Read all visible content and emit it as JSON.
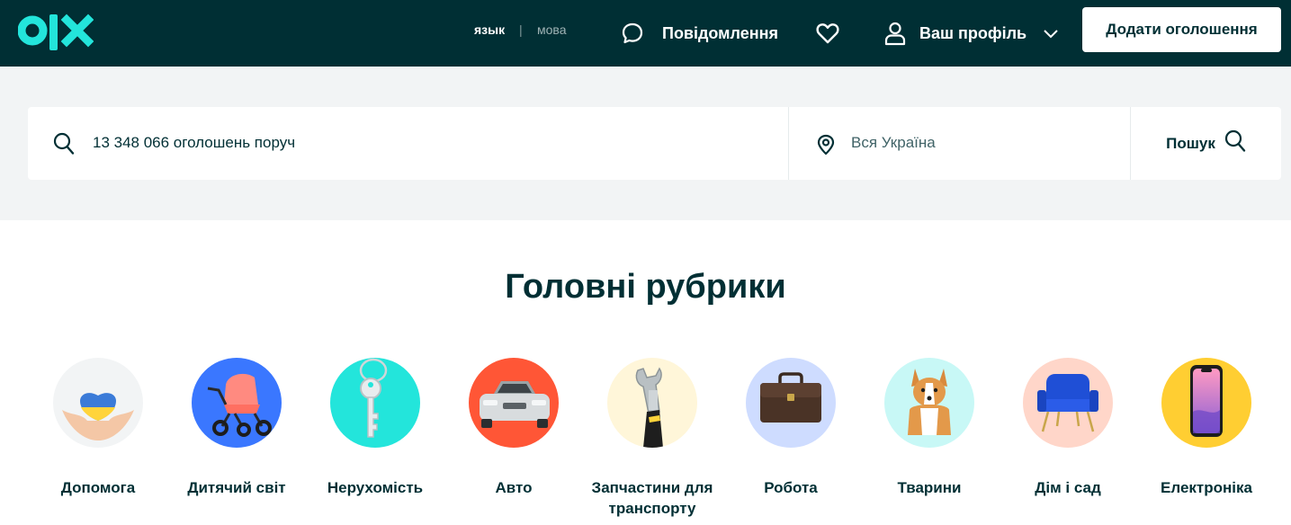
{
  "header": {
    "logo_text": "olx",
    "lang_ru": "язык",
    "lang_separator": "|",
    "lang_ua": "мова",
    "messages_label": "Повідомлення",
    "profile_label": "Ваш профіль",
    "add_button_label": "Додати оголошення"
  },
  "search": {
    "query_placeholder": "13 348 066 оголошень поруч",
    "location_placeholder": "Вся Україна",
    "button_label": "Пошук"
  },
  "main": {
    "section_title": "Головні рубрики",
    "categories": [
      {
        "label": "Допомога",
        "icon": "heart-hands-icon",
        "bg": "#f2f4f5"
      },
      {
        "label": "Дитячий світ",
        "icon": "stroller-icon",
        "bg": "#3a77ff"
      },
      {
        "label": "Нерухомість",
        "icon": "key-icon",
        "bg": "#23e5db"
      },
      {
        "label": "Авто",
        "icon": "car-icon",
        "bg": "#ff5636"
      },
      {
        "label": "Запчастини для транспорту",
        "icon": "wrench-icon",
        "bg": "#fff6d9"
      },
      {
        "label": "Робота",
        "icon": "briefcase-icon",
        "bg": "#cedcff"
      },
      {
        "label": "Тварини",
        "icon": "dog-icon",
        "bg": "#c8f8f6"
      },
      {
        "label": "Дім і сад",
        "icon": "armchair-icon",
        "bg": "#ffd6c9"
      },
      {
        "label": "Електроніка",
        "icon": "smartphone-icon",
        "bg": "#ffce32"
      }
    ]
  },
  "colors": {
    "header_bg": "#002f34",
    "brand_teal": "#23e5db",
    "text_primary": "#002f34",
    "band_bg": "#f2f4f5"
  }
}
